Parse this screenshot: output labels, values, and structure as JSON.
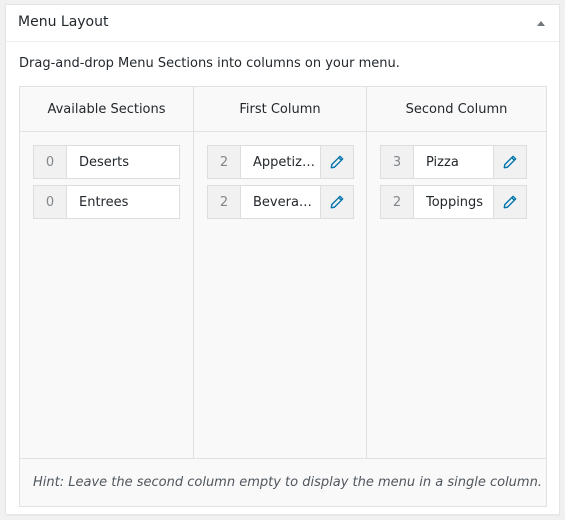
{
  "panel": {
    "title": "Menu Layout",
    "toggle_icon": "triangle-up-icon"
  },
  "description": "Drag-and-drop Menu Sections into columns on your menu.",
  "columns": [
    {
      "header": "Available Sections",
      "items": [
        {
          "count": "0",
          "label": "Deserts"
        },
        {
          "count": "0",
          "label": "Entrees"
        }
      ]
    },
    {
      "header": "First Column",
      "items": [
        {
          "count": "2",
          "label": "Appetizers",
          "edit_icon": "pencil-icon"
        },
        {
          "count": "2",
          "label": "Beverages",
          "edit_icon": "pencil-icon"
        }
      ]
    },
    {
      "header": "Second Column",
      "items": [
        {
          "count": "3",
          "label": "Pizza",
          "edit_icon": "pencil-icon"
        },
        {
          "count": "2",
          "label": "Toppings",
          "edit_icon": "pencil-icon"
        }
      ]
    }
  ],
  "hint": "Hint: Leave the second column empty to display the menu in a single column.",
  "colors": {
    "edit_icon": "#0073aa",
    "count_text": "#82878c",
    "border": "#dddddd"
  }
}
